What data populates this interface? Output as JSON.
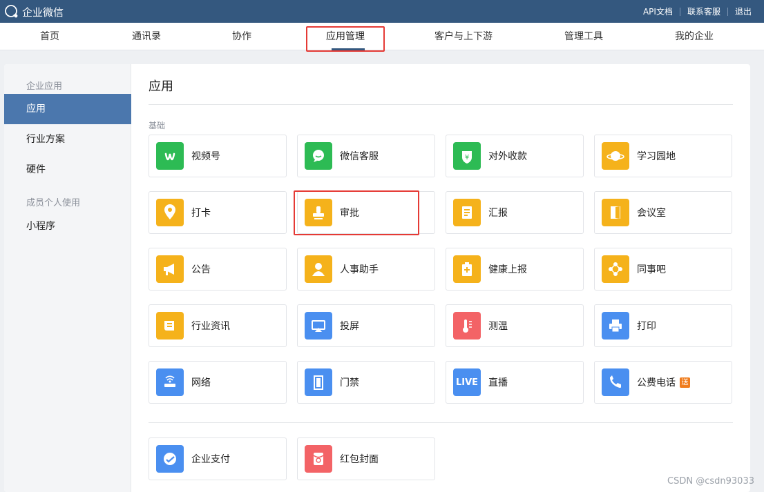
{
  "app": {
    "title": "企业微信"
  },
  "header_links": [
    "API文档",
    "联系客服",
    "退出"
  ],
  "nav": {
    "items": [
      "首页",
      "通讯录",
      "协作",
      "应用管理",
      "客户与上下游",
      "管理工具",
      "我的企业"
    ],
    "active": "应用管理"
  },
  "sidebar": {
    "group1": "企业应用",
    "items1": [
      "应用",
      "行业方案",
      "硬件"
    ],
    "group2": "成员个人使用",
    "items2": [
      "小程序"
    ],
    "active": "应用"
  },
  "main": {
    "title": "应用",
    "section_basic": "基础",
    "apps": [
      {
        "label": "视频号",
        "icon": "video-channel-icon",
        "color": "#2dbb54"
      },
      {
        "label": "微信客服",
        "icon": "wechat-service-icon",
        "color": "#2dbb54"
      },
      {
        "label": "对外收款",
        "icon": "payment-collection-icon",
        "color": "#2dbb54"
      },
      {
        "label": "学习园地",
        "icon": "planet-icon",
        "color": "#f5b21b"
      },
      {
        "label": "打卡",
        "icon": "location-pin-icon",
        "color": "#f5b21b"
      },
      {
        "label": "审批",
        "icon": "stamp-icon",
        "color": "#f5b21b"
      },
      {
        "label": "汇报",
        "icon": "report-icon",
        "color": "#f5b21b"
      },
      {
        "label": "会议室",
        "icon": "door-icon",
        "color": "#f5b21b"
      },
      {
        "label": "公告",
        "icon": "megaphone-icon",
        "color": "#f5b21b"
      },
      {
        "label": "人事助手",
        "icon": "person-icon",
        "color": "#f5b21b"
      },
      {
        "label": "健康上报",
        "icon": "health-clipboard-icon",
        "color": "#f5b21b"
      },
      {
        "label": "同事吧",
        "icon": "share-network-icon",
        "color": "#f5b21b"
      },
      {
        "label": "行业资讯",
        "icon": "news-icon",
        "color": "#f5b21b"
      },
      {
        "label": "投屏",
        "icon": "screen-cast-icon",
        "color": "#4a8ff0"
      },
      {
        "label": "测温",
        "icon": "thermometer-icon",
        "color": "#f36366"
      },
      {
        "label": "打印",
        "icon": "printer-icon",
        "color": "#4a8ff0"
      },
      {
        "label": "网络",
        "icon": "router-icon",
        "color": "#4a8ff0"
      },
      {
        "label": "门禁",
        "icon": "access-door-icon",
        "color": "#4a8ff0"
      },
      {
        "label": "直播",
        "icon": "live-icon",
        "color": "#4a8ff0",
        "icon_text": "LIVE"
      },
      {
        "label": "公费电话",
        "icon": "phone-icon",
        "color": "#4a8ff0",
        "badge": "送"
      }
    ],
    "apps_extra": [
      {
        "label": "企业支付",
        "icon": "enterprise-pay-icon",
        "color": "#4a8ff0"
      },
      {
        "label": "红包封面",
        "icon": "red-envelope-icon",
        "color": "#f36366"
      }
    ]
  },
  "watermark": "CSDN @csdn93033"
}
